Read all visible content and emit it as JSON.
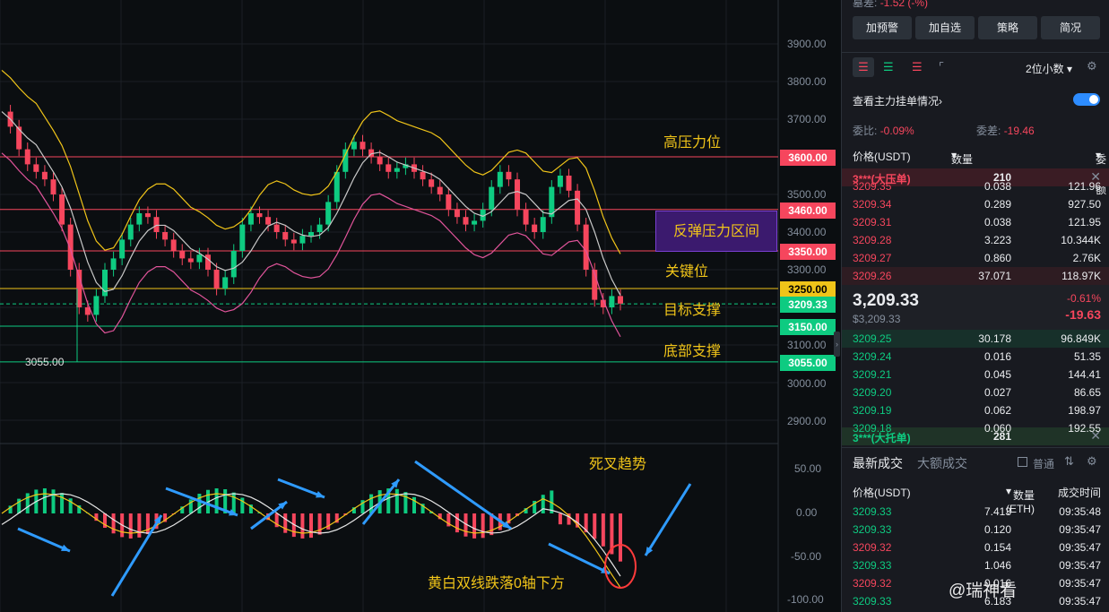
{
  "top_partial": {
    "label": "墓差:",
    "value": "-1.52 (-%)"
  },
  "buttons": [
    "加预警",
    "加自选",
    "策略",
    "简况"
  ],
  "toolbar": {
    "decimal_select": "2位小数"
  },
  "main_orders": {
    "label": "查看主力挂单情况",
    "arrow": "›"
  },
  "ratio": {
    "bid_ratio_label": "委比:",
    "bid_ratio": "-0.09%",
    "diff_label": "委差:",
    "diff": "-19.46"
  },
  "orderbook_header": {
    "price": "价格(USDT)",
    "qty": "数量 (ETH)",
    "total": "委托额"
  },
  "ask_big": {
    "label": "3***(大压单)",
    "qty": "210"
  },
  "asks": [
    {
      "price": "3209.35",
      "qty": "0.038",
      "total": "121.96"
    },
    {
      "price": "3209.34",
      "qty": "0.289",
      "total": "927.50"
    },
    {
      "price": "3209.31",
      "qty": "0.038",
      "total": "121.95"
    },
    {
      "price": "3209.28",
      "qty": "3.223",
      "total": "10.344K"
    },
    {
      "price": "3209.27",
      "qty": "0.860",
      "total": "2.76K"
    },
    {
      "price": "3209.26",
      "qty": "37.071",
      "total": "118.97K"
    }
  ],
  "last": {
    "price": "3,209.33",
    "usd": "$3,209.33",
    "pct": "-0.61%",
    "chg": "-19.63"
  },
  "bids": [
    {
      "price": "3209.25",
      "qty": "30.178",
      "total": "96.849K"
    },
    {
      "price": "3209.24",
      "qty": "0.016",
      "total": "51.35"
    },
    {
      "price": "3209.21",
      "qty": "0.045",
      "total": "144.41"
    },
    {
      "price": "3209.20",
      "qty": "0.027",
      "total": "86.65"
    },
    {
      "price": "3209.19",
      "qty": "0.062",
      "total": "198.97"
    },
    {
      "price": "3209.18",
      "qty": "0.060",
      "total": "192.55"
    }
  ],
  "bid_big": {
    "label": "3***(大托单)",
    "qty": "281"
  },
  "trades_tabs": {
    "latest": "最新成交",
    "large": "大额成交",
    "normal": "普通"
  },
  "trades_header": {
    "price": "价格(USDT)",
    "qty": "数量(ETH)",
    "time": "成交时间"
  },
  "trades": [
    {
      "price": "3209.33",
      "qty": "7.413",
      "time": "09:35:48",
      "side": "green"
    },
    {
      "price": "3209.33",
      "qty": "0.120",
      "time": "09:35:47",
      "side": "green"
    },
    {
      "price": "3209.32",
      "qty": "0.154",
      "time": "09:35:47",
      "side": "red"
    },
    {
      "price": "3209.33",
      "qty": "1.046",
      "time": "09:35:47",
      "side": "green"
    },
    {
      "price": "3209.32",
      "qty": "0.016",
      "time": "09:35:47",
      "side": "red"
    },
    {
      "price": "3209.33",
      "qty": "6.183",
      "time": "09:35:47",
      "side": "green"
    }
  ],
  "chart": {
    "price_axis": [
      "3900.00",
      "3800.00",
      "3700.00",
      "3500.00",
      "3400.00",
      "3300.00",
      "3100.00",
      "3000.00",
      "2900.00"
    ],
    "macd_axis": [
      "50.00",
      "0.00",
      "-50.00",
      "-100.00"
    ],
    "levels": [
      {
        "price": "3600.00",
        "color": "#f6465d",
        "label": "高压力位"
      },
      {
        "price": "3460.00",
        "color": "#f6465d",
        "label": ""
      },
      {
        "price": "3350.00",
        "color": "#f6465d",
        "label": ""
      },
      {
        "price": "3250.00",
        "color": "#f0c419",
        "label": "关键位"
      },
      {
        "price": "3209.33",
        "color": "#0ecb81",
        "label": "目标支撑"
      },
      {
        "price": "3150.00",
        "color": "#0ecb81",
        "label": "底部支撑"
      },
      {
        "price": "3055.00",
        "color": "#0ecb81",
        "label": ""
      }
    ],
    "zone_label": "反弹压力区间",
    "low_label": "3055.00",
    "macd_labels": {
      "death_cross": "死叉趋势",
      "note": "黄白双线跌落0轴下方"
    },
    "colors": {
      "up": "#0ecb81",
      "down": "#f6465d",
      "upper_band": "#f0c419",
      "mid": "#c8c8c8",
      "lower_band": "#e0549a"
    }
  },
  "watermark": "@瑞神看"
}
